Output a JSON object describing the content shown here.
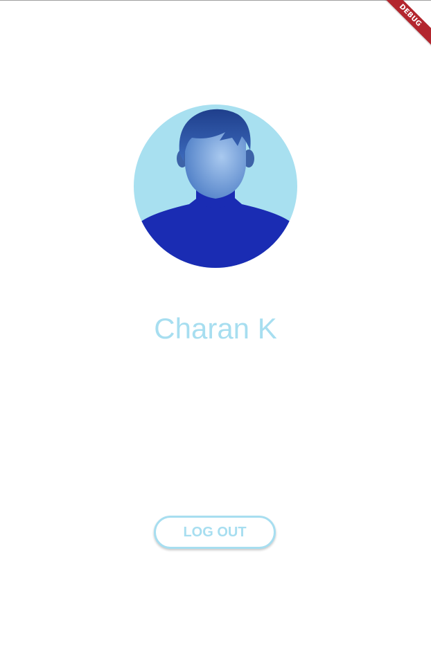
{
  "debug_banner": {
    "label": "DEBUG",
    "color": "#b3262e"
  },
  "profile": {
    "avatar_icon": "user-avatar-icon",
    "name": "Charan K"
  },
  "actions": {
    "logout_label": "LOG OUT"
  },
  "colors": {
    "accent": "#a7def0",
    "avatar_background": "#a8e0f0",
    "avatar_body": "#1a2cb3",
    "background": "#ffffff"
  }
}
